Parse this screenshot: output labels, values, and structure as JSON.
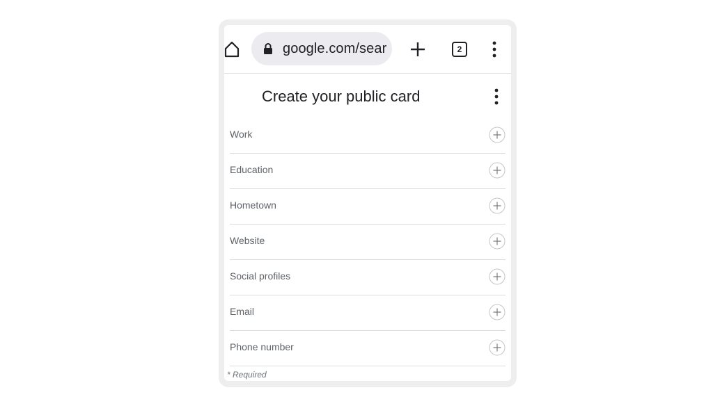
{
  "browser": {
    "url": "google.com/sear",
    "tab_count": "2",
    "icons": {
      "home": "home-icon",
      "lock": "lock-icon",
      "new_tab": "plus-icon",
      "tabs": "tab-switcher-icon",
      "menu": "more-vert-icon"
    }
  },
  "card": {
    "title": "Create your public card",
    "menu_icon": "more-vert-icon",
    "fields": [
      {
        "label": "Work"
      },
      {
        "label": "Education"
      },
      {
        "label": "Hometown"
      },
      {
        "label": "Website"
      },
      {
        "label": "Social profiles"
      },
      {
        "label": "Email"
      },
      {
        "label": "Phone number"
      }
    ],
    "add_icon": "add-circle-icon",
    "required_note": "* Required"
  },
  "colors": {
    "frame": "#eeeeee",
    "url_pill": "#ececf0",
    "text_primary": "#202124",
    "text_secondary": "#5f6368",
    "divider": "#dadce0"
  }
}
